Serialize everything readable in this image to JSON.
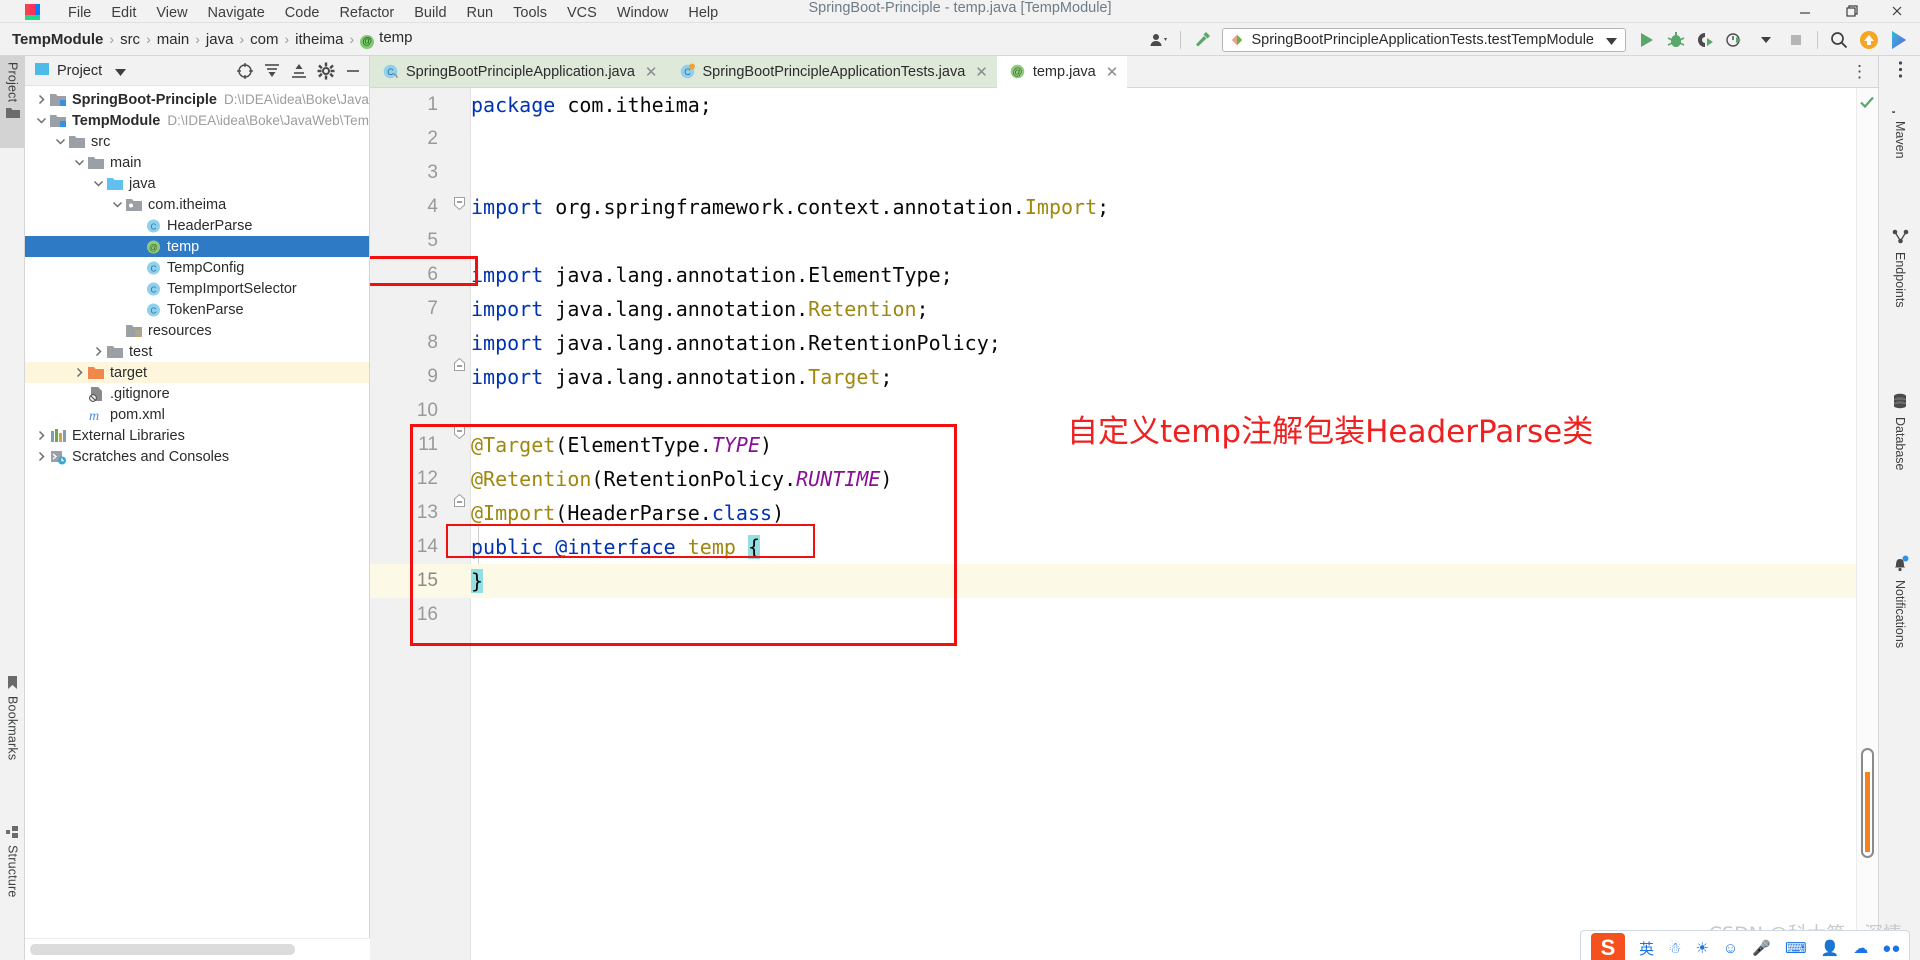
{
  "window": {
    "title": "SpringBoot-Principle - temp.java [TempModule]",
    "minimize_label": "—",
    "maximize_label": "❐",
    "close_label": "✕"
  },
  "menu": {
    "items": [
      "File",
      "Edit",
      "View",
      "Navigate",
      "Code",
      "Refactor",
      "Build",
      "Run",
      "Tools",
      "VCS",
      "Window",
      "Help"
    ]
  },
  "breadcrumb": {
    "items": [
      "TempModule",
      "src",
      "main",
      "java",
      "com",
      "itheima"
    ],
    "separator": "›",
    "leaf": "temp",
    "leaf_icon": "@"
  },
  "toolbar": {
    "run_config": "SpringBootPrincipleApplicationTests.testTempModule",
    "run_config_caret": "▼",
    "icons": [
      {
        "name": "profile-icon",
        "glyph": "👤"
      },
      {
        "name": "build-hammer-icon",
        "glyph": "⚒"
      },
      {
        "name": "run-icon",
        "glyph": "▶"
      },
      {
        "name": "debug-icon",
        "glyph": "🐞"
      },
      {
        "name": "run-with-coverage-icon",
        "glyph": "▶"
      },
      {
        "name": "profiler-icon",
        "glyph": "⏱"
      },
      {
        "name": "stop-icon",
        "glyph": "■"
      },
      {
        "name": "search-everywhere-icon",
        "glyph": "🔍"
      },
      {
        "name": "updates-icon",
        "glyph": "↑"
      },
      {
        "name": "ide-feature-icon",
        "glyph": "◖"
      }
    ]
  },
  "left_strip": {
    "tabs": [
      {
        "label": "Project",
        "icon": "folder-icon",
        "active": true
      },
      {
        "label": "Bookmarks",
        "icon": "bookmark-icon",
        "active": false
      },
      {
        "label": "Structure",
        "icon": "structure-icon",
        "active": false
      }
    ]
  },
  "right_strip": {
    "tabs": [
      {
        "label": "Maven",
        "icon": "maven-icon"
      },
      {
        "label": "Endpoints",
        "icon": "endpoints-icon"
      },
      {
        "label": "Database",
        "icon": "database-icon"
      },
      {
        "label": "Notifications",
        "icon": "notifications-icon"
      }
    ],
    "more_label": "⋮"
  },
  "project_panel": {
    "title": "Project",
    "caret": "▾",
    "tools": [
      {
        "name": "select-opened-file-icon",
        "glyph": "⊕"
      },
      {
        "name": "expand-all-icon",
        "glyph": "≣"
      },
      {
        "name": "collapse-all-icon",
        "glyph": "≡"
      },
      {
        "name": "settings-gear-icon",
        "glyph": "⚙"
      },
      {
        "name": "hide-panel-icon",
        "glyph": "—"
      }
    ],
    "tree": [
      {
        "label": "SpringBoot-Principle",
        "path": "D:\\IDEA\\idea\\Boke\\JavaWeb\\",
        "indent": 0,
        "arrow": "right",
        "icon": "module-icon",
        "bold": true,
        "state": "normal"
      },
      {
        "label": "TempModule",
        "path": "D:\\IDEA\\idea\\Boke\\JavaWeb\\TempM",
        "indent": 0,
        "arrow": "down",
        "icon": "module-icon",
        "bold": true,
        "state": "normal"
      },
      {
        "label": "src",
        "path": "",
        "indent": 1,
        "arrow": "down",
        "icon": "folder-icon",
        "bold": false,
        "state": "normal"
      },
      {
        "label": "main",
        "path": "",
        "indent": 2,
        "arrow": "down",
        "icon": "folder-icon",
        "bold": false,
        "state": "normal"
      },
      {
        "label": "java",
        "path": "",
        "indent": 3,
        "arrow": "down",
        "icon": "source-folder-icon",
        "bold": false,
        "state": "normal"
      },
      {
        "label": "com.itheima",
        "path": "",
        "indent": 4,
        "arrow": "down",
        "icon": "package-icon",
        "bold": false,
        "state": "normal"
      },
      {
        "label": "HeaderParse",
        "path": "",
        "indent": 5,
        "arrow": "none",
        "icon": "class-icon",
        "bold": false,
        "state": "normal"
      },
      {
        "label": "temp",
        "path": "",
        "indent": 5,
        "arrow": "none",
        "icon": "annotation-icon",
        "bold": false,
        "state": "selected"
      },
      {
        "label": "TempConfig",
        "path": "",
        "indent": 5,
        "arrow": "none",
        "icon": "class-icon",
        "bold": false,
        "state": "normal"
      },
      {
        "label": "TempImportSelector",
        "path": "",
        "indent": 5,
        "arrow": "none",
        "icon": "class-icon",
        "bold": false,
        "state": "normal"
      },
      {
        "label": "TokenParse",
        "path": "",
        "indent": 5,
        "arrow": "none",
        "icon": "class-icon",
        "bold": false,
        "state": "normal"
      },
      {
        "label": "resources",
        "path": "",
        "indent": 4,
        "arrow": "none",
        "icon": "resources-folder-icon",
        "bold": false,
        "state": "normal"
      },
      {
        "label": "test",
        "path": "",
        "indent": 3,
        "arrow": "right",
        "icon": "folder-icon",
        "bold": false,
        "state": "normal"
      },
      {
        "label": "target",
        "path": "",
        "indent": 2,
        "arrow": "right",
        "icon": "target-folder-icon",
        "bold": false,
        "state": "highlighted"
      },
      {
        "label": ".gitignore",
        "path": "",
        "indent": 2,
        "arrow": "none",
        "icon": "gitignore-icon",
        "bold": false,
        "state": "normal"
      },
      {
        "label": "pom.xml",
        "path": "",
        "indent": 2,
        "arrow": "none",
        "icon": "maven-file-icon",
        "bold": false,
        "state": "normal"
      },
      {
        "label": "External Libraries",
        "path": "",
        "indent": 0,
        "arrow": "right",
        "icon": "libraries-icon",
        "bold": false,
        "state": "normal"
      },
      {
        "label": "Scratches and Consoles",
        "path": "",
        "indent": 0,
        "arrow": "right",
        "icon": "scratches-icon",
        "bold": false,
        "state": "normal"
      }
    ]
  },
  "editor": {
    "tabs": [
      {
        "label": "SpringBootPrincipleApplication.java",
        "icon": "java-class-icon",
        "active": false,
        "close": "✕"
      },
      {
        "label": "SpringBootPrincipleApplicationTests.java",
        "icon": "java-test-class-icon",
        "active": false,
        "close": "✕"
      },
      {
        "label": "temp.java",
        "icon": "annotation-icon",
        "active": true,
        "close": "✕"
      }
    ],
    "tab_more": "⋮",
    "inspection_status": "✔",
    "lines": [
      {
        "no": "1",
        "segments": [
          {
            "t": "package",
            "c": "kw"
          },
          {
            "t": " com.itheima;",
            "c": "plain"
          }
        ]
      },
      {
        "no": "2",
        "segments": []
      },
      {
        "no": "3",
        "segments": []
      },
      {
        "no": "4",
        "segments": [
          {
            "t": "import",
            "c": "kw"
          },
          {
            "t": " org.springframework.context.annotation.",
            "c": "plain"
          },
          {
            "t": "Import",
            "c": "ann"
          },
          {
            "t": ";",
            "c": "plain"
          }
        ]
      },
      {
        "no": "5",
        "segments": []
      },
      {
        "no": "6",
        "segments": [
          {
            "t": "import",
            "c": "kw"
          },
          {
            "t": " java.lang.annotation.ElementType;",
            "c": "plain"
          }
        ]
      },
      {
        "no": "7",
        "segments": [
          {
            "t": "import",
            "c": "kw"
          },
          {
            "t": " java.lang.annotation.",
            "c": "plain"
          },
          {
            "t": "Retention",
            "c": "ann"
          },
          {
            "t": ";",
            "c": "plain"
          }
        ]
      },
      {
        "no": "8",
        "segments": [
          {
            "t": "import",
            "c": "kw"
          },
          {
            "t": " java.lang.annotation.RetentionPolicy;",
            "c": "plain"
          }
        ]
      },
      {
        "no": "9",
        "segments": [
          {
            "t": "import",
            "c": "kw"
          },
          {
            "t": " java.lang.annotation.",
            "c": "plain"
          },
          {
            "t": "Target",
            "c": "ann"
          },
          {
            "t": ";",
            "c": "plain"
          }
        ]
      },
      {
        "no": "10",
        "segments": []
      },
      {
        "no": "11",
        "segments": [
          {
            "t": "@Target",
            "c": "ann"
          },
          {
            "t": "(ElementType.",
            "c": "plain"
          },
          {
            "t": "TYPE",
            "c": "ital"
          },
          {
            "t": ")",
            "c": "plain"
          }
        ]
      },
      {
        "no": "12",
        "segments": [
          {
            "t": "@Retention",
            "c": "ann"
          },
          {
            "t": "(RetentionPolicy.",
            "c": "plain"
          },
          {
            "t": "RUNTIME",
            "c": "ital"
          },
          {
            "t": ")",
            "c": "plain"
          }
        ]
      },
      {
        "no": "13",
        "segments": [
          {
            "t": "@Import",
            "c": "ann"
          },
          {
            "t": "(HeaderParse.",
            "c": "plain"
          },
          {
            "t": "class",
            "c": "kw"
          },
          {
            "t": ")",
            "c": "plain"
          }
        ]
      },
      {
        "no": "14",
        "segments": [
          {
            "t": "public",
            "c": "kw"
          },
          {
            "t": " ",
            "c": "plain"
          },
          {
            "t": "@interface",
            "c": "kw"
          },
          {
            "t": " ",
            "c": "plain"
          },
          {
            "t": "temp",
            "c": "ann"
          },
          {
            "t": " ",
            "c": "plain"
          },
          {
            "t": "{",
            "c": "plain brace-hl"
          }
        ]
      },
      {
        "no": "15",
        "segments": [
          {
            "t": "}",
            "c": "plain brace-hl"
          }
        ],
        "highlight": true
      },
      {
        "no": "16",
        "segments": []
      }
    ]
  },
  "annotations": {
    "chinese_note": "自定义temp注解包装HeaderParse类"
  },
  "watermark": {
    "text": "CSDN @科大第一深情"
  }
}
